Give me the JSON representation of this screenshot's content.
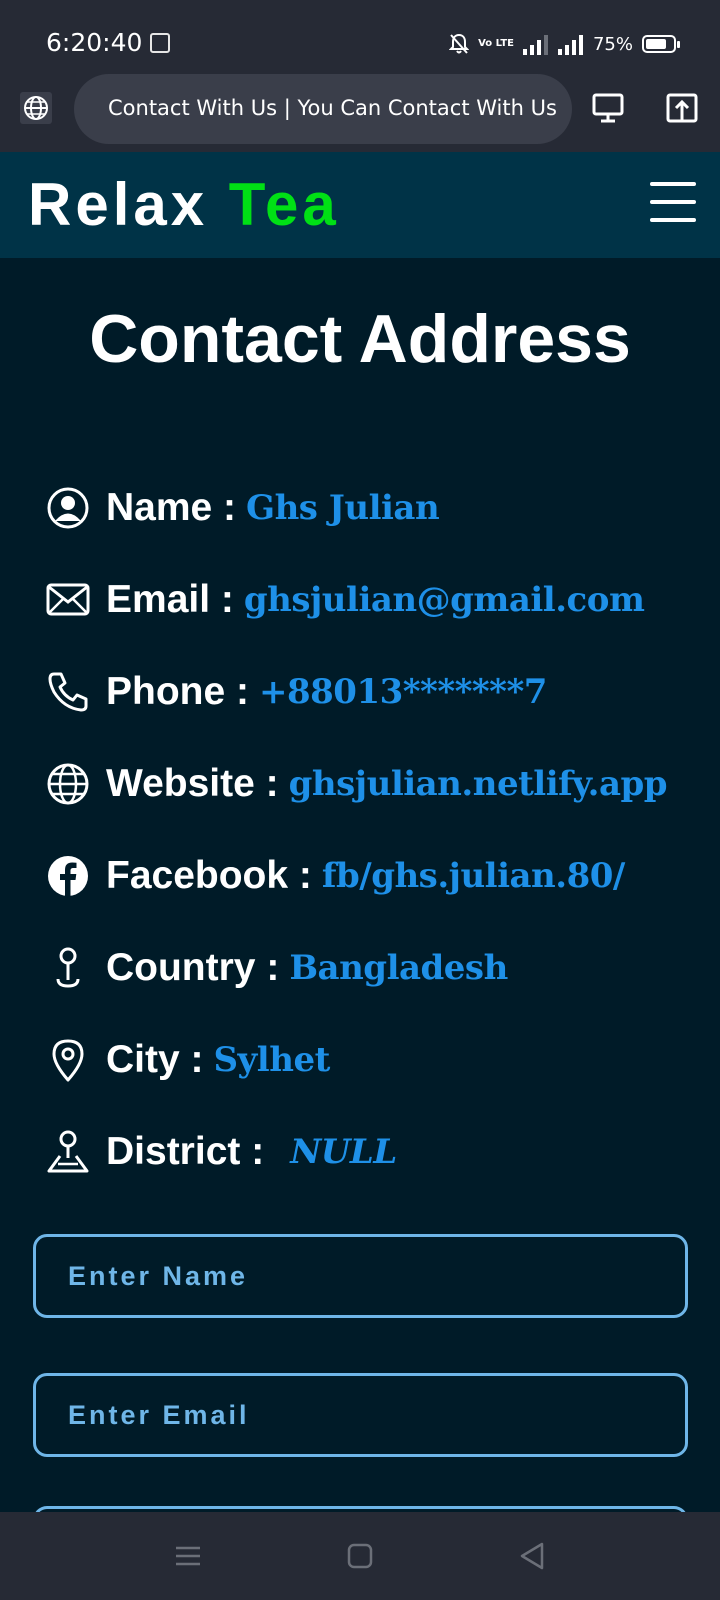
{
  "status_bar": {
    "time": "6:20:40",
    "network": "Vo LTE",
    "battery": "75%",
    "battery_level": 0.75
  },
  "browser": {
    "url_title": "Contact With Us | You Can Contact With Us"
  },
  "header": {
    "logo_part1": "Relax",
    "logo_part2": "Tea",
    "logo_accent_color": "#00e015"
  },
  "page": {
    "title": "Contact Address"
  },
  "contact": [
    {
      "icon": "user-circle-icon",
      "label": "Name :",
      "value": "Ghs Julian"
    },
    {
      "icon": "envelope-icon",
      "label": "Email :",
      "value": "ghsjulian@gmail.com"
    },
    {
      "icon": "phone-icon",
      "label": "Phone :",
      "value": "+88013*******7"
    },
    {
      "icon": "globe-icon",
      "label": "Website :",
      "value": "ghsjulian.netlify.app"
    },
    {
      "icon": "facebook-icon",
      "label": "Facebook :",
      "value": "fb/ghs.julian.80/"
    },
    {
      "icon": "pin-icon",
      "label": "Country :",
      "value": "Bangladesh"
    },
    {
      "icon": "location-marker-icon",
      "label": "City :",
      "value": "Sylhet"
    },
    {
      "icon": "map-person-icon",
      "label": "District :",
      "value": "NULL"
    }
  ],
  "form": {
    "name_placeholder": "Enter Name",
    "email_placeholder": "Enter Email"
  },
  "colors": {
    "background": "#001b28",
    "header": "#003347",
    "value_text": "#1e90e8",
    "input_border": "#6fb6e8"
  }
}
